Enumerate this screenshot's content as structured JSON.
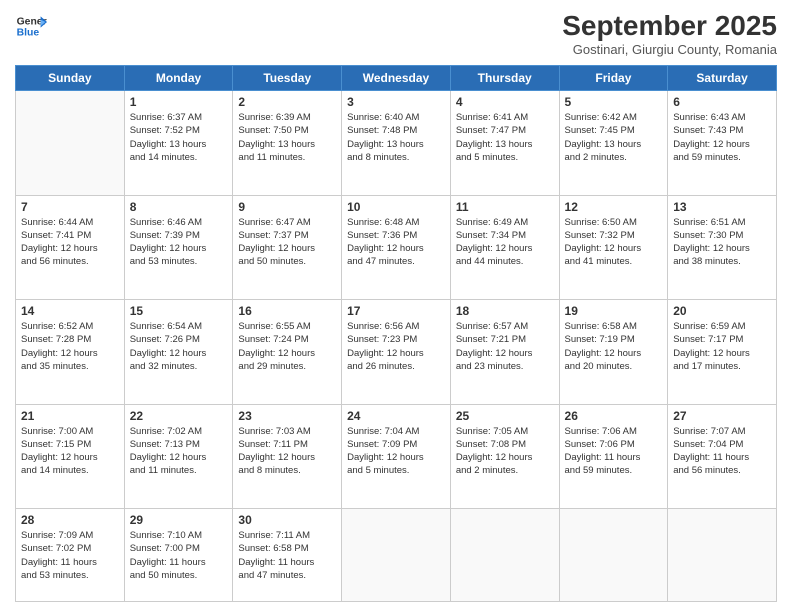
{
  "header": {
    "logo_line1": "General",
    "logo_line2": "Blue",
    "month": "September 2025",
    "location": "Gostinari, Giurgiu County, Romania"
  },
  "weekdays": [
    "Sunday",
    "Monday",
    "Tuesday",
    "Wednesday",
    "Thursday",
    "Friday",
    "Saturday"
  ],
  "weeks": [
    [
      {
        "day": "",
        "info": ""
      },
      {
        "day": "1",
        "info": "Sunrise: 6:37 AM\nSunset: 7:52 PM\nDaylight: 13 hours\nand 14 minutes."
      },
      {
        "day": "2",
        "info": "Sunrise: 6:39 AM\nSunset: 7:50 PM\nDaylight: 13 hours\nand 11 minutes."
      },
      {
        "day": "3",
        "info": "Sunrise: 6:40 AM\nSunset: 7:48 PM\nDaylight: 13 hours\nand 8 minutes."
      },
      {
        "day": "4",
        "info": "Sunrise: 6:41 AM\nSunset: 7:47 PM\nDaylight: 13 hours\nand 5 minutes."
      },
      {
        "day": "5",
        "info": "Sunrise: 6:42 AM\nSunset: 7:45 PM\nDaylight: 13 hours\nand 2 minutes."
      },
      {
        "day": "6",
        "info": "Sunrise: 6:43 AM\nSunset: 7:43 PM\nDaylight: 12 hours\nand 59 minutes."
      }
    ],
    [
      {
        "day": "7",
        "info": "Sunrise: 6:44 AM\nSunset: 7:41 PM\nDaylight: 12 hours\nand 56 minutes."
      },
      {
        "day": "8",
        "info": "Sunrise: 6:46 AM\nSunset: 7:39 PM\nDaylight: 12 hours\nand 53 minutes."
      },
      {
        "day": "9",
        "info": "Sunrise: 6:47 AM\nSunset: 7:37 PM\nDaylight: 12 hours\nand 50 minutes."
      },
      {
        "day": "10",
        "info": "Sunrise: 6:48 AM\nSunset: 7:36 PM\nDaylight: 12 hours\nand 47 minutes."
      },
      {
        "day": "11",
        "info": "Sunrise: 6:49 AM\nSunset: 7:34 PM\nDaylight: 12 hours\nand 44 minutes."
      },
      {
        "day": "12",
        "info": "Sunrise: 6:50 AM\nSunset: 7:32 PM\nDaylight: 12 hours\nand 41 minutes."
      },
      {
        "day": "13",
        "info": "Sunrise: 6:51 AM\nSunset: 7:30 PM\nDaylight: 12 hours\nand 38 minutes."
      }
    ],
    [
      {
        "day": "14",
        "info": "Sunrise: 6:52 AM\nSunset: 7:28 PM\nDaylight: 12 hours\nand 35 minutes."
      },
      {
        "day": "15",
        "info": "Sunrise: 6:54 AM\nSunset: 7:26 PM\nDaylight: 12 hours\nand 32 minutes."
      },
      {
        "day": "16",
        "info": "Sunrise: 6:55 AM\nSunset: 7:24 PM\nDaylight: 12 hours\nand 29 minutes."
      },
      {
        "day": "17",
        "info": "Sunrise: 6:56 AM\nSunset: 7:23 PM\nDaylight: 12 hours\nand 26 minutes."
      },
      {
        "day": "18",
        "info": "Sunrise: 6:57 AM\nSunset: 7:21 PM\nDaylight: 12 hours\nand 23 minutes."
      },
      {
        "day": "19",
        "info": "Sunrise: 6:58 AM\nSunset: 7:19 PM\nDaylight: 12 hours\nand 20 minutes."
      },
      {
        "day": "20",
        "info": "Sunrise: 6:59 AM\nSunset: 7:17 PM\nDaylight: 12 hours\nand 17 minutes."
      }
    ],
    [
      {
        "day": "21",
        "info": "Sunrise: 7:00 AM\nSunset: 7:15 PM\nDaylight: 12 hours\nand 14 minutes."
      },
      {
        "day": "22",
        "info": "Sunrise: 7:02 AM\nSunset: 7:13 PM\nDaylight: 12 hours\nand 11 minutes."
      },
      {
        "day": "23",
        "info": "Sunrise: 7:03 AM\nSunset: 7:11 PM\nDaylight: 12 hours\nand 8 minutes."
      },
      {
        "day": "24",
        "info": "Sunrise: 7:04 AM\nSunset: 7:09 PM\nDaylight: 12 hours\nand 5 minutes."
      },
      {
        "day": "25",
        "info": "Sunrise: 7:05 AM\nSunset: 7:08 PM\nDaylight: 12 hours\nand 2 minutes."
      },
      {
        "day": "26",
        "info": "Sunrise: 7:06 AM\nSunset: 7:06 PM\nDaylight: 11 hours\nand 59 minutes."
      },
      {
        "day": "27",
        "info": "Sunrise: 7:07 AM\nSunset: 7:04 PM\nDaylight: 11 hours\nand 56 minutes."
      }
    ],
    [
      {
        "day": "28",
        "info": "Sunrise: 7:09 AM\nSunset: 7:02 PM\nDaylight: 11 hours\nand 53 minutes."
      },
      {
        "day": "29",
        "info": "Sunrise: 7:10 AM\nSunset: 7:00 PM\nDaylight: 11 hours\nand 50 minutes."
      },
      {
        "day": "30",
        "info": "Sunrise: 7:11 AM\nSunset: 6:58 PM\nDaylight: 11 hours\nand 47 minutes."
      },
      {
        "day": "",
        "info": ""
      },
      {
        "day": "",
        "info": ""
      },
      {
        "day": "",
        "info": ""
      },
      {
        "day": "",
        "info": ""
      }
    ]
  ]
}
